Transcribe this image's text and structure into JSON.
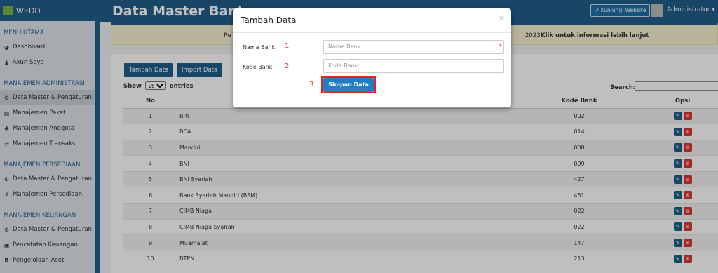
{
  "sidebar": {
    "brand": "WEDD",
    "sections": [
      {
        "title": "MENU UTAMA",
        "items": [
          {
            "label": "Dashboard",
            "icon": "dashboard-icon"
          },
          {
            "label": "Akun Saya",
            "icon": "user-icon"
          }
        ]
      },
      {
        "title": "MANAJEMEN ADMINISTRASI",
        "items": [
          {
            "label": "Data Master & Pengaturan",
            "icon": "gears-icon"
          },
          {
            "label": "Manajemen Paket",
            "icon": "package-icon"
          },
          {
            "label": "Manajemen Anggota",
            "icon": "users-icon"
          },
          {
            "label": "Manajemen Transaksi",
            "icon": "transaction-icon"
          }
        ]
      },
      {
        "title": "MANAJEMEN PERSEDIAAN",
        "items": [
          {
            "label": "Data Master & Pengaturan",
            "icon": "gears-icon"
          },
          {
            "label": "Manajemen Persediaan",
            "icon": "inventory-icon"
          }
        ]
      },
      {
        "title": "MANAJEMEN KEUANGAN",
        "items": [
          {
            "label": "Data Master & Pengaturan",
            "icon": "gears-icon"
          },
          {
            "label": "Pencatatan Keuangan",
            "icon": "money-icon"
          },
          {
            "label": "Pengelolaan Aset",
            "icon": "asset-icon"
          }
        ]
      }
    ]
  },
  "header": {
    "page_title": "Data Master Bank",
    "visit_label": "Kunjungi Website",
    "user_label": "Administrator"
  },
  "alert": {
    "prefix": "Pe",
    "suffix": "2023.",
    "link": "Klik untuk informasi lebih lanjut"
  },
  "toolbar": {
    "add_label": "Tambah Data",
    "import_label": "Import Data",
    "show_label": "Show",
    "entries_value": "25",
    "entries_label": "entries",
    "search_label": "Search:"
  },
  "table": {
    "headers": [
      "No",
      "",
      "Kode Bank",
      "Opsi"
    ],
    "rows": [
      {
        "no": "1",
        "name": "BRI",
        "code": "002"
      },
      {
        "no": "2",
        "name": "BCA",
        "code": "014"
      },
      {
        "no": "3",
        "name": "Mandiri",
        "code": "008"
      },
      {
        "no": "4",
        "name": "BNI",
        "code": "009"
      },
      {
        "no": "5",
        "name": "BNI Syariah",
        "code": "427"
      },
      {
        "no": "6",
        "name": "Bank Syariah Mandiri (BSM)",
        "code": "451"
      },
      {
        "no": "7",
        "name": "CIMB Niaga",
        "code": "022"
      },
      {
        "no": "8",
        "name": "CIMB Niaga Syariah",
        "code": "022"
      },
      {
        "no": "9",
        "name": "Muamalat",
        "code": "147"
      },
      {
        "no": "10",
        "name": "BTPN",
        "code": "213"
      }
    ]
  },
  "modal": {
    "title": "Tambah Data",
    "close": "×",
    "fields": [
      {
        "label": "Nama Bank",
        "placeholder": "Nama Bank",
        "step": "1",
        "required": "*"
      },
      {
        "label": "Kode Bank",
        "placeholder": "Kode Bank",
        "step": "2"
      }
    ],
    "submit_step": "3",
    "submit_label": "Simpan Data"
  }
}
